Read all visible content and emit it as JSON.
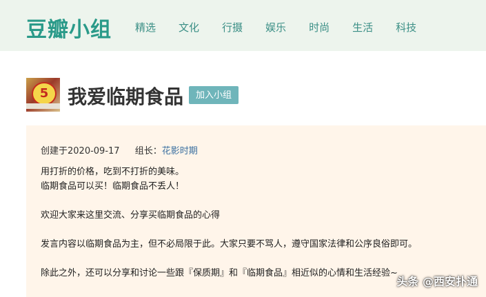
{
  "header": {
    "logo": "豆瓣小组",
    "nav": [
      "精选",
      "文化",
      "行摄",
      "娱乐",
      "时尚",
      "生活",
      "科技"
    ]
  },
  "group": {
    "logo_text": "5",
    "title": "我爱临期食品",
    "join_label": "加入小组"
  },
  "info": {
    "created": "创建于2020-09-17",
    "owner_label": "组长：",
    "owner_name": "花影时期",
    "lines": [
      "用打折的价格，吃到不打折的美味。",
      "临期食品可以买！临期食品不丢人！",
      "",
      "欢迎大家来这里交流、分享买临期食品的心得",
      "",
      "发言内容以临期食品为主，但不必局限于此。大家只要不骂人，遵守国家法律和公序良俗即可。",
      "",
      "除此之外，还可以分享和讨论一些跟『保质期』和『临期食品』相近似的心情和生活经验~"
    ]
  },
  "watermark": "头条 @西安扑通",
  "colors": {
    "brand": "#2a9a89",
    "nav": "#3b8f86",
    "header_bg": "#edf4ed",
    "join_button": "#6fb5ba",
    "info_bg": "#fff5ea"
  }
}
